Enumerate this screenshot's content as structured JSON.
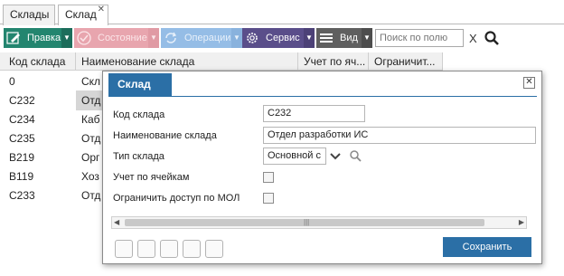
{
  "tabs": [
    {
      "label": "Склады"
    },
    {
      "label": "Склад",
      "close": "✕"
    }
  ],
  "toolbar": {
    "edit": "Правка",
    "state": "Состояние",
    "operations": "Операции",
    "service": "Сервис",
    "view": "Вид",
    "search_placeholder": "Поиск по полю",
    "clear": "X"
  },
  "grid": {
    "columns": [
      "Код склада",
      "Наименование склада",
      "Учет по яч...",
      "Ограничит..."
    ],
    "rows": [
      {
        "code": "0",
        "name": "Скл"
      },
      {
        "code": "C232",
        "name": "Отд"
      },
      {
        "code": "C234",
        "name": "Каб"
      },
      {
        "code": "C235",
        "name": "Отд"
      },
      {
        "code": "B219",
        "name": "Орг"
      },
      {
        "code": "B119",
        "name": "Хоз"
      },
      {
        "code": "C233",
        "name": "Отд"
      }
    ]
  },
  "dialog": {
    "title": "Склад",
    "fields": {
      "code_label": "Код склада",
      "code_value": "C232",
      "name_label": "Наименование склада",
      "name_value": "Отдел разработки ИС",
      "type_label": "Тип склада",
      "type_value": "Основной с",
      "cells_label": "Учет по ячейкам",
      "mol_label": "Ограничить доступ по МОЛ"
    },
    "save": "Сохранить"
  }
}
